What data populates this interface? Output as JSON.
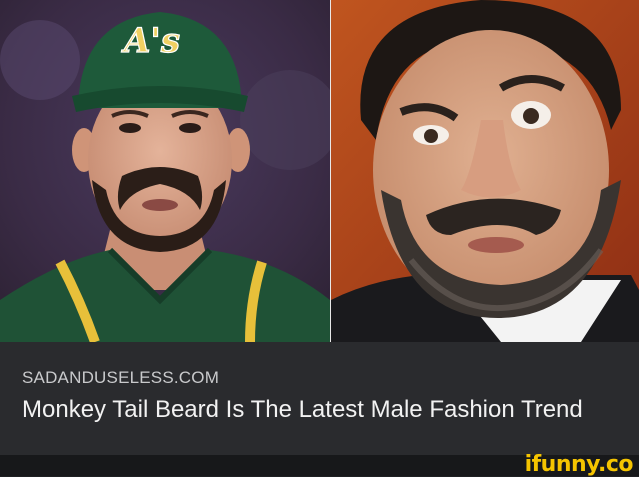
{
  "article": {
    "source": "SADANDUSELESS.COM",
    "headline": "Monkey Tail Beard Is The Latest Male Fashion Trend"
  },
  "photos": {
    "left": {
      "cap_logo": "A's",
      "icon": "baseball-player-photo"
    },
    "right": {
      "icon": "bearded-man-photo"
    }
  },
  "watermark": {
    "text": "ifunny.co",
    "color": "#f5c400"
  }
}
